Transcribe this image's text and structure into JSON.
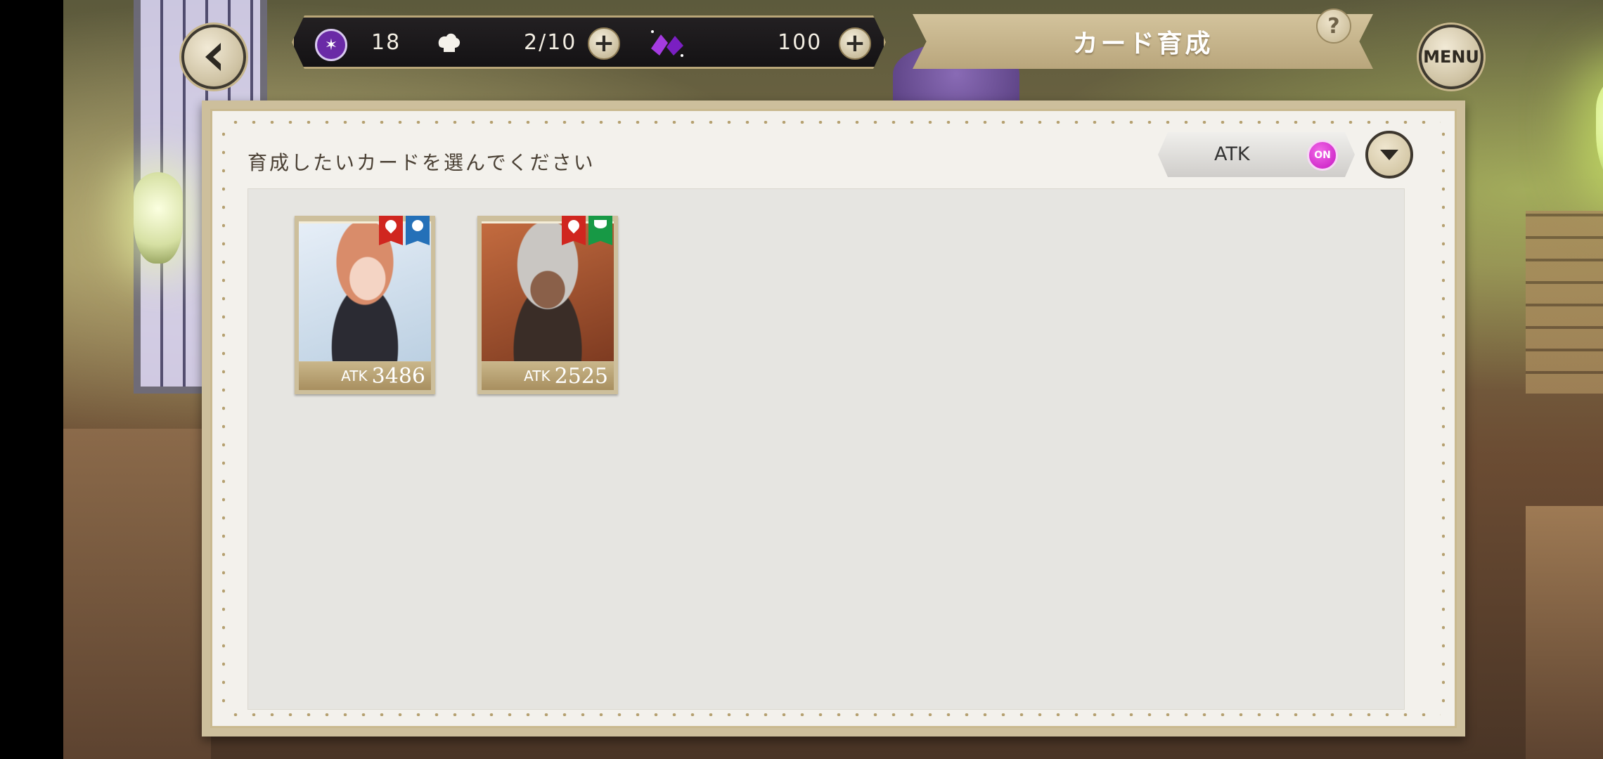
{
  "currency": {
    "gems": "18",
    "stamina": "2/10",
    "potions": "100"
  },
  "title": "カード育成",
  "help_label": "?",
  "menu_label": "MENU",
  "panel": {
    "instruction": "育成したいカードを選んでください",
    "sort": {
      "label": "ATK",
      "toggle": "ON"
    }
  },
  "cards": [
    {
      "stat_label": "ATK",
      "stat_value": "3486",
      "attributes": [
        "fire",
        "water"
      ]
    },
    {
      "stat_label": "ATK",
      "stat_value": "2525",
      "attributes": [
        "fire",
        "flora"
      ]
    }
  ],
  "icons": {
    "back": "chevron-left-icon",
    "gem": "gem-icon",
    "stamina": "stamina-icon",
    "potion": "potion-icon",
    "plus": "plus-icon",
    "dropdown": "chevron-down-icon"
  },
  "colors": {
    "accent_gold": "#cdbf9c",
    "toggle_on": "#d62ad0",
    "fire": "#d0261f",
    "water": "#2470b8",
    "flora": "#179945"
  }
}
